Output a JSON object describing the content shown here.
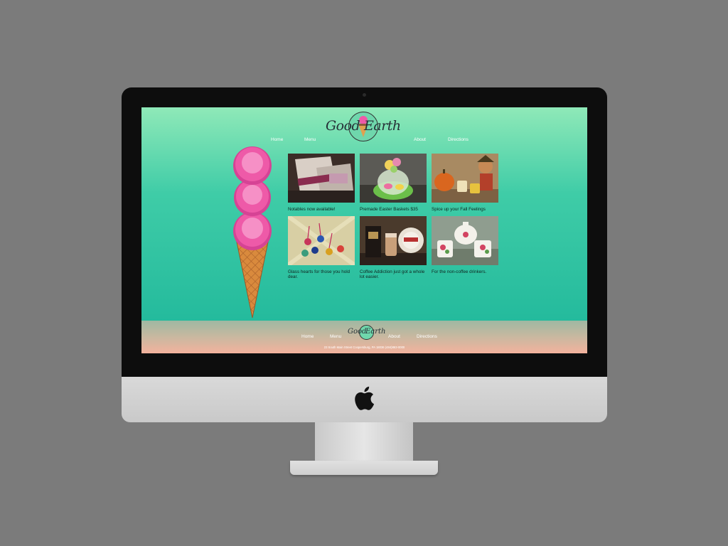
{
  "site": {
    "logo": {
      "left": "Good",
      "right": "Earth"
    },
    "nav": [
      "Home",
      "Menu",
      "About",
      "Directions"
    ],
    "gallery": [
      {
        "caption": "Notables now available!"
      },
      {
        "caption": "Premade Easter Baskets $35"
      },
      {
        "caption": "Spice up your Fall Feelings"
      },
      {
        "caption": "Glass hearts for those you hold dear."
      },
      {
        "caption": "Coffee Addiction just got a whole lot easier."
      },
      {
        "caption": "For the non-coffee drinkers."
      }
    ],
    "footer": {
      "nav": [
        "Home",
        "Menu",
        "About",
        "Directions"
      ],
      "logo": {
        "left": "Good",
        "right": "Earth"
      },
      "address": "23 South Main Street Coopersburg, PA 18036 (484)863-0000"
    },
    "colors": {
      "accent": "#1db69a",
      "scoop": "#ee5aa8",
      "cone": "#d98a3d",
      "footer_bottom": "#f3b29d"
    }
  },
  "device": {
    "brand_icon": "apple-logo-icon"
  }
}
